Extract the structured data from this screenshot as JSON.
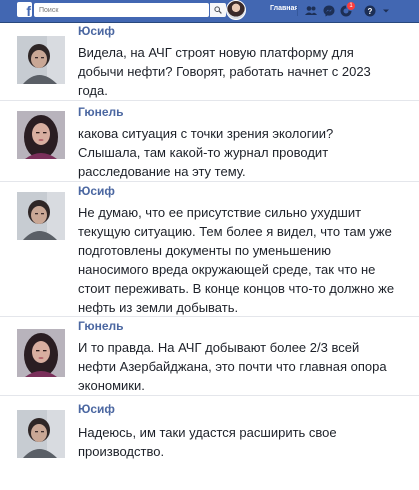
{
  "header": {
    "logo": "f",
    "search_placeholder": "Поиск",
    "home_label": "Главная",
    "notification_count": "1",
    "colors": {
      "bar": "#4267b2",
      "name": "#4b67a1"
    }
  },
  "messages": [
    {
      "author": "Юсиф",
      "text": "Видела, на АЧГ строят новую платформу для добычи нефти? Говорят, работать начнет с 2023 года."
    },
    {
      "author": "Гюнель",
      "text": " какова ситуация с точки зрения экологии? Слышала, там какой-то журнал проводит расследование на эту тему."
    },
    {
      "author": "Юсиф",
      "text": "Не думаю, что ее присутствие сильно ухудшит текущую ситуацию. Тем более я видел, что там уже подготовлены документы по уменьшению наносимого вреда окружающей среде, так что не стоит переживать. В конце концов что-то должно же нефть из земли добывать."
    },
    {
      "author": "Гюнель",
      "text": "И то правда. На АЧГ добывают более 2/3 всей нефти Азербайджана, это почти что главная опора экономики."
    },
    {
      "author": "Юсиф",
      "text": "Надеюсь, им таки удастся расширить свое производство."
    }
  ]
}
